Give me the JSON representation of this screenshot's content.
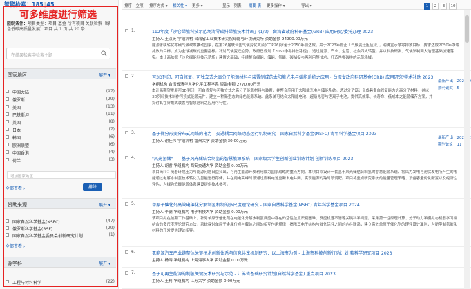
{
  "left": {
    "result_label": "智能检索：",
    "result_count": "185",
    "result_count2": "45",
    "overlay_text": "可多维度进行筛选",
    "conditions_label": "限制条件：",
    "conditions_text": "项目类型：项目 基金 所有项目 关联检索（绿色低碳高质量发展）项目 共 1 页 共 20 条",
    "search_placeholder": "在结果检索中检索主题",
    "sections": [
      {
        "title": "国家地区",
        "action": "展开 ▾"
      },
      {
        "title": "资助来源",
        "action": "展开 ▾"
      },
      {
        "title": "源学科",
        "action": "展开 ▾"
      }
    ],
    "region_items": [
      {
        "label": "中国大陆",
        "count": "(97)"
      },
      {
        "label": "俄罗斯",
        "count": "(29)"
      },
      {
        "label": "美国",
        "count": "(13)"
      },
      {
        "label": "巴基斯坦",
        "count": "(11)"
      },
      {
        "label": "英国",
        "count": "(8)"
      },
      {
        "label": "日本",
        "count": "(7)"
      },
      {
        "label": "韩国",
        "count": "(6)"
      },
      {
        "label": "欧洲联盟",
        "count": "(6)"
      },
      {
        "label": "中国香港",
        "count": "(4)"
      },
      {
        "label": "荷兰",
        "count": "(3)"
      }
    ],
    "region_filter_placeholder": "增加国家地区",
    "view_all": "全部查看 ›",
    "sort_button": "排除",
    "funding_items": [
      {
        "label": "国家自然科学基金(NSFC)",
        "count": "(47)"
      },
      {
        "label": "俄罗斯科学基金(RSF)",
        "count": "(29)"
      },
      {
        "label": "国家自然科学基金委员会创新研究计划",
        "count": "(1)"
      }
    ],
    "funding_view_all": "全部查看 ›",
    "subject_items": [
      {
        "label": "工程与材料科学",
        "count": "(22)"
      }
    ]
  },
  "toolbar": {
    "items": [
      "排序：立项",
      "排序方式 ▾",
      "相关性 ▾",
      "更多 ▾",
      "显示：列表",
      "摘要 表",
      "更多操作 ▾",
      "导出 ▾"
    ],
    "pages": [
      "1",
      "2",
      "3",
      "10"
    ]
  },
  "records": [
    {
      "num": "1.",
      "title": "112年度「沙仑绿能科技示范场清零碳排绿能技术计画」(1/2)  -  台湾省政府科研基金(GRB) 应用研究/委托办理 2023",
      "meta": "主持人 王汉英  学组机构 台湾省工业技术研究院绿能与环境研究所  资助金额 94900.00万元",
      "abs": "能源永续转化零碳气候政策推动国家，在第26届联合国气候变化大会(COP26)承诺于2050年前达成，并于2023年修正「气候变迁因应法」，明确宣示净零排放目标，要求达成2050年净零排放的目标，成为全球减碳的重要指标。针对气候变迁趋势，政府已规划「2050净零排放路径」，透过能源、产业、生活、社会四大转型，并以科技研发、气候法制两大治理基础加速落实。本计画依据「沙仑绿能科技示范场」建置之基础，持续整合绿能、储能、氢能、碳捕捉与再利用等技术，打造净零碳排的示范场域。",
      "side": "",
      "side2": ""
    },
    {
      "num": "2.",
      "title": "可3D列印、可自修复、可独立式之高分子能源材料与装置制成的太阳能光电与储能系统之应用  -  台湾省政府科研基金(GRB) 应用研究/学术补助 2023",
      "meta": "学组机构 台湾省清华大学化学工程学系  资助金额 2770.00万元",
      "abs": "本计画期望发展可3D列印、可自修复与可独立式之高分子能源材料与装置，并整合应用于太阳能光电与储能系统。透过分子设计合成具备自修复能力之高分子材料，并以3D列印技术制作可撓式能源元件，建立一种新型态的绿色能源系统。此系统可结合太阳能电池、超级电容与锂离子电池，提供高效率、长寿命、低成本之能源储存方案，并探讨其在穿戴式装置与智慧建筑之应用可行性。",
      "side": "最新产出：2024-10-01",
      "side2": "期刊论文：5"
    },
    {
      "num": "3.",
      "title": "基于微分形变分布式网络的电力—交通耦合网络动态运行机制研究  -  国家自然科学基金(NSFC) 青年科学基金项目 2023",
      "meta": "主持人 谢仕伟  学组机构 福州大学  资助金额 30.00万元",
      "abs": "",
      "side": "最新产出：2024-11-01",
      "side2": "期刊论文：11"
    },
    {
      "num": "4.",
      "title": "\"风光氢储\"——基于风光储结合制氢的智慧能源系统  -  国家级大学生创新创业训练计划 创新训练项目 2023",
      "meta": "主持人 胡睿  学组机构 西安交通大学  资助金额 0.00万元",
      "abs": "项目简介：随着环境压力与能源问题日益突出，可再生能源开发利用成为国家战略的重点方向。本项目拟设计一套基于风光储结合制氢的智慧能源系统，将风力发电与光伏发电所产生的电能通过电解水制氢技术转化为氢能进行存储，并在用电高峰时段通过燃料电池重新发电并网，实现能源的跨时段调配。项目将重点研究系统的能量管理策略、设备容量优化配置以及经济性评估，为绿色低碳能源体系建设提供技术参考。",
      "side": "",
      "side2": ""
    },
    {
      "num": "5.",
      "title": "单原子催化剂高效电催化分解制氢机制的多尺度理论研究  -  国家自然科学基金(NSFC) 青年科学基金项目 2024",
      "meta": "主持人 李德  学组机构 电子科技大学  资助金额 0.00万元",
      "abs": "该项目拟在前期工作基础上，针对单原子催化剂在电催化分解水制氢反应中存在的活性位点识别困难、反应机理不清等关键科学问题，采用第一性原理计算、分子动力学模拟与机器学习相结合的多尺度理论研究方法，系统探讨单原子金属位点与载体之间的相互作用规律，揭示其电子结构与催化活性之间的内在联系，建立高效单原子催化剂的理性设计准则，为新型制氢催化材料的开发提供理论指导。",
      "side": "",
      "side2": ""
    },
    {
      "num": "6.",
      "title": "氢能源汽车产业链整体关键技术创新体系与信息共享机制研究：以上海市为例  -  上海市科技创新行动计划 软科学研究项目 2023",
      "meta": "主持人 杨涛  学组机构 上海海事大学  资助金额 0.00万元",
      "abs": "",
      "side": "",
      "side2": ""
    },
    {
      "num": "7.",
      "title": "基于可再生能源的制氢关键技术研究与示范  -  江苏省基础研究计划(自然科学基金) 重点项目 2023",
      "meta": "主持人 王柯  学组机构 江苏大学  资助金额 0.00万元",
      "abs": "",
      "side": "",
      "side2": ""
    }
  ]
}
